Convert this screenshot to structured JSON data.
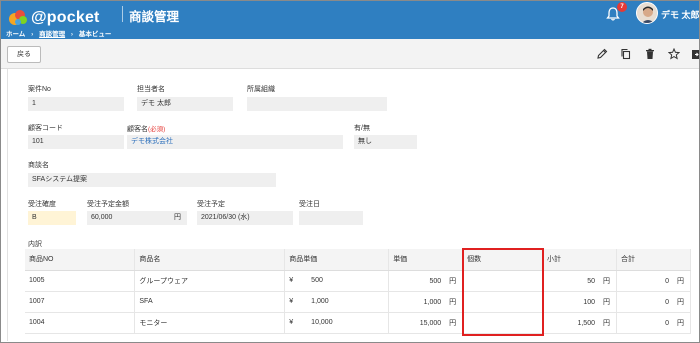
{
  "header": {
    "logo_text": "@pocket",
    "title": "商談管理",
    "breadcrumb": [
      "ホーム",
      "商談管理",
      "基本ビュー"
    ],
    "breadcrumb_sep": "›",
    "notification_count": "7",
    "user_name": "デモ 太郎"
  },
  "toolbar": {
    "back_label": "戻る",
    "icons": [
      "pencil-icon",
      "copy-icon",
      "trash-icon",
      "star-icon",
      "export-icon"
    ]
  },
  "form": {
    "case_no": {
      "label": "案件No",
      "value": "1"
    },
    "owner": {
      "label": "担当者名",
      "value": "デモ 太郎"
    },
    "org": {
      "label": "所属組織",
      "value": ""
    },
    "customer_code": {
      "label": "顧客コード",
      "value": "101"
    },
    "customer_name": {
      "label": "顧客名",
      "required": "(必須)",
      "value": "デモ株式会社"
    },
    "presence": {
      "label": "有/無",
      "value": "無し"
    },
    "deal_name": {
      "label": "商談名",
      "value": "SFAシステム提案"
    },
    "accuracy": {
      "label": "受注確度",
      "value": "B"
    },
    "expected_amount": {
      "label": "受注予定金額",
      "value": "60,000",
      "unit": "円"
    },
    "expected_date": {
      "label": "受注予定",
      "value": "2021/06/30 (水)"
    },
    "order_date": {
      "label": "受注日",
      "value": ""
    },
    "details_label": "内訳"
  },
  "table": {
    "headers": [
      "商品NO",
      "商品名",
      "商品単価",
      "単価",
      "個数",
      "小計",
      "合計"
    ],
    "rows": [
      {
        "no": "1005",
        "name": "グループウェア",
        "yen": "¥",
        "unit_price": "500",
        "price": "500",
        "en": "円",
        "qty": "",
        "subtotal": "50",
        "total": "0"
      },
      {
        "no": "1007",
        "name": "SFA",
        "yen": "¥",
        "unit_price": "1,000",
        "price": "1,000",
        "en": "円",
        "qty": "",
        "subtotal": "100",
        "total": "0"
      },
      {
        "no": "1004",
        "name": "モニター",
        "yen": "¥",
        "unit_price": "10,000",
        "price": "15,000",
        "en": "円",
        "qty": "",
        "subtotal": "1,500",
        "total": "0"
      }
    ]
  },
  "colors": {
    "header_bg": "#2f7fc1",
    "highlight": "#e02020",
    "link": "#2a6ebb",
    "accent_field": "#fff4d6"
  }
}
